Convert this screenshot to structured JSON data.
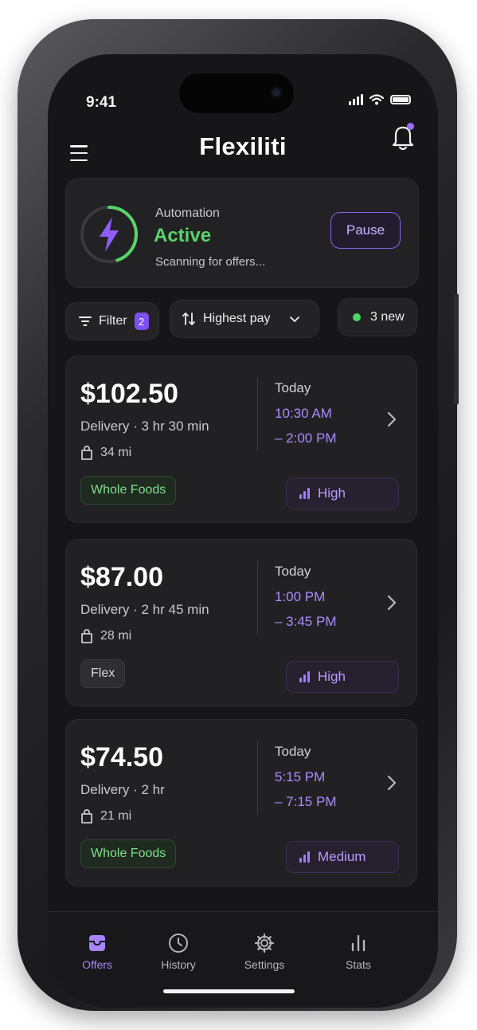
{
  "status_bar": {
    "time": "9:41"
  },
  "header": {
    "title": "Flexiliti"
  },
  "automation": {
    "label": "Automation",
    "status": "Active",
    "subtitle": "Scanning for offers...",
    "pause_label": "Pause",
    "progress": 0.45
  },
  "filters": {
    "filter_label": "Filter",
    "filter_count": "2",
    "sort_label": "Highest pay",
    "new_label": "3 new"
  },
  "offers": [
    {
      "price": "$102.50",
      "type": "Delivery · 3 hr 30 min",
      "distance": "34 mi",
      "store": "Whole Foods",
      "day": "Today",
      "time_start": "10:30 AM",
      "time_end": "– 2:00 PM",
      "level": "High"
    },
    {
      "price": "$87.00",
      "type": "Delivery · 2 hr 45 min",
      "distance": "28 mi",
      "store": "Flex",
      "day": "Today",
      "time_start": "1:00 PM",
      "time_end": "– 3:45 PM",
      "level": "High"
    },
    {
      "price": "$74.50",
      "type": "Delivery · 2 hr",
      "distance": "21 mi",
      "store": "Whole Foods",
      "day": "Today",
      "time_start": "5:15 PM",
      "time_end": "– 7:15 PM",
      "level": "Medium"
    }
  ],
  "tabs": [
    {
      "label": "Offers",
      "icon": "offers-icon",
      "active": true
    },
    {
      "label": "History",
      "icon": "clock-icon"
    },
    {
      "label": "Settings",
      "icon": "gear-icon"
    },
    {
      "label": "Stats",
      "icon": "stats-icon"
    }
  ],
  "colors": {
    "accent": "#9b6bff",
    "active_green": "#5ad36b",
    "background": "#161618"
  }
}
